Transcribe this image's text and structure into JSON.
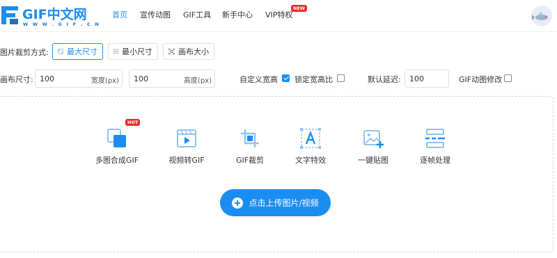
{
  "header": {
    "logo_title": "GIF中文网",
    "logo_sub": "W W W . G I F . C N",
    "nav": [
      {
        "label": "首页",
        "active": true
      },
      {
        "label": "宣传动图",
        "active": false
      },
      {
        "label": "GIF工具",
        "active": false
      },
      {
        "label": "新手中心",
        "active": false
      },
      {
        "label": "VIP特权",
        "active": false
      }
    ],
    "vip_badge": "NEW"
  },
  "crop": {
    "label": "图片裁剪方式:",
    "options": [
      {
        "label": "最大尺寸",
        "selected": true
      },
      {
        "label": "最小尺寸",
        "selected": false
      },
      {
        "label": "画布大小",
        "selected": false
      }
    ]
  },
  "canvas": {
    "label": "画布尺寸:",
    "width_value": "100",
    "width_suffix": "宽度(px)",
    "height_value": "100",
    "height_suffix": "高度(px)",
    "custom_label": "自定义宽高",
    "custom_checked": true,
    "lock_label": "锁定宽高比",
    "lock_checked": false,
    "delay_label": "默认延迟:",
    "delay_value": "100",
    "modify_label": "GIF动图修改",
    "modify_checked": false
  },
  "tools": {
    "hot_badge": "HOT",
    "items": [
      {
        "label": "多图合成GIF",
        "icon": "layers-icon"
      },
      {
        "label": "视频转GIF",
        "icon": "video-icon"
      },
      {
        "label": "GIF裁剪",
        "icon": "crop-icon"
      },
      {
        "label": "文字特效",
        "icon": "text-icon"
      },
      {
        "label": "一键贴图",
        "icon": "image-add-icon"
      },
      {
        "label": "逐帧处理",
        "icon": "frames-icon"
      }
    ]
  },
  "upload": {
    "label": "点击上传图片/视频"
  },
  "colors": {
    "accent": "#1c8df0",
    "badge": "#f02b2b"
  }
}
